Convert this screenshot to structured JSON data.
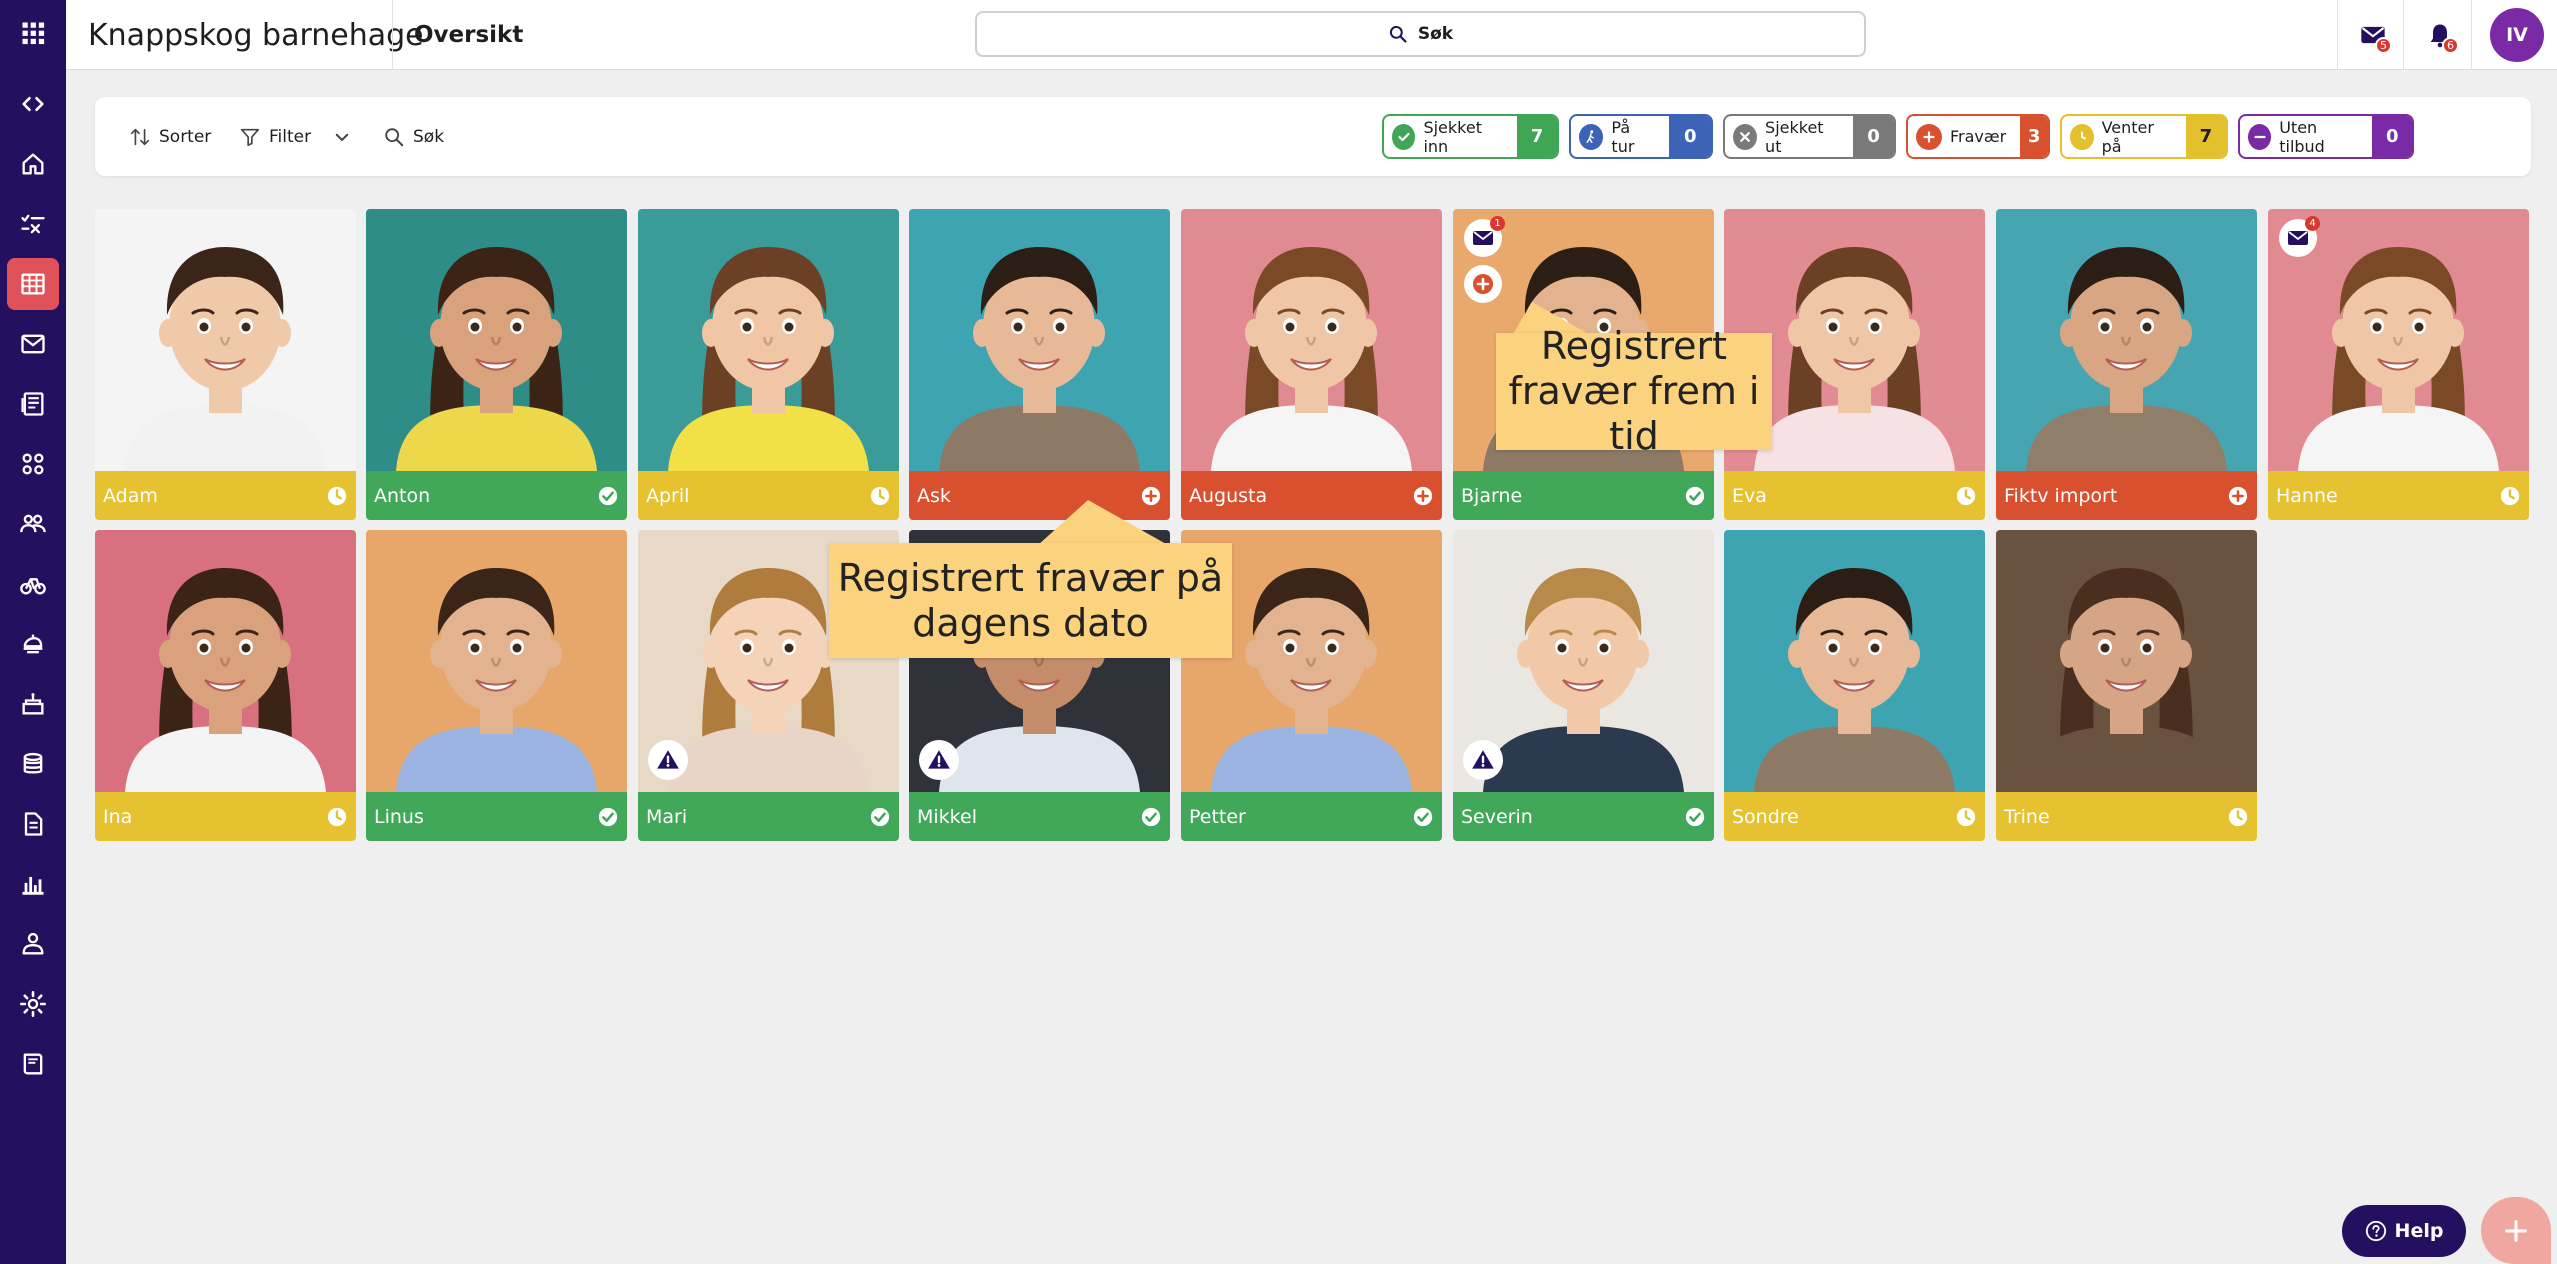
{
  "app": {
    "org_name": "Knappskog barnehage",
    "page_title": "Oversikt",
    "search_label": "Søk",
    "messages_badge": "5",
    "notifications_badge": "6",
    "avatar_initials": "IV"
  },
  "sidebar": {
    "items": [
      {
        "icon": "code-toggle-icon"
      },
      {
        "icon": "home-icon"
      },
      {
        "icon": "checklist-icon"
      },
      {
        "icon": "calendar-grid-icon",
        "active": true
      },
      {
        "icon": "mail-icon"
      },
      {
        "icon": "newspaper-icon"
      },
      {
        "icon": "group-icon"
      },
      {
        "icon": "people-icon"
      },
      {
        "icon": "bike-icon"
      },
      {
        "icon": "food-icon"
      },
      {
        "icon": "cake-icon"
      },
      {
        "icon": "coins-icon"
      },
      {
        "icon": "document-icon"
      },
      {
        "icon": "chart-icon"
      },
      {
        "icon": "staff-icon"
      },
      {
        "icon": "settings-icon"
      },
      {
        "icon": "book-icon"
      }
    ]
  },
  "toolbar": {
    "sort_label": "Sorter",
    "filter_label": "Filter",
    "search_label": "Søk"
  },
  "status_chips": [
    {
      "key": "in",
      "label": "Sjekket inn",
      "count": "7",
      "color": "#3fa656"
    },
    {
      "key": "trip",
      "label": "På tur",
      "count": "0",
      "color": "#3c63b5"
    },
    {
      "key": "out",
      "label": "Sjekket ut",
      "count": "0",
      "color": "#7a7a7a"
    },
    {
      "key": "absent",
      "label": "Fravær",
      "count": "3",
      "color": "#d9502f"
    },
    {
      "key": "waiting",
      "label": "Venter på",
      "count": "7",
      "color": "#e4c02f"
    },
    {
      "key": "none",
      "label": "Uten tilbud",
      "count": "0",
      "color": "#7b2aa6"
    }
  ],
  "colors": {
    "checked_in": "#41a85a",
    "waiting": "#e6c231",
    "absent": "#d9502f",
    "sidebar": "#24105f",
    "active_sidebar": "#e0525a"
  },
  "children": [
    {
      "name": "Adam",
      "status": "waiting",
      "bg": "#f4f4f4",
      "skin": "#f0c9a8",
      "hair": "#3a2518",
      "shirt": "#f2f2f2",
      "long_hair": false
    },
    {
      "name": "Anton",
      "status": "checked_in",
      "bg": "#2f8d88",
      "skin": "#d9a27c",
      "hair": "#3b2416",
      "shirt": "#ecd84a",
      "long_hair": true
    },
    {
      "name": "April",
      "status": "waiting",
      "bg": "#3a9b98",
      "skin": "#f0c6a5",
      "hair": "#6b4024",
      "shirt": "#f1e046",
      "long_hair": true
    },
    {
      "name": "Ask",
      "status": "absent",
      "bg": "#3fa4b2",
      "skin": "#e8b996",
      "hair": "#2c1d15",
      "shirt": "#8c7a66",
      "long_hair": false
    },
    {
      "name": "Augusta",
      "status": "absent",
      "bg": "#e28a91",
      "skin": "#f0c7a6",
      "hair": "#7a4a26",
      "shirt": "#f5f5f5",
      "long_hair": true
    },
    {
      "name": "Bjarne",
      "status": "checked_in",
      "bg": "#e9a96d",
      "skin": "#e2b38e",
      "hair": "#2c1d15",
      "shirt": "#8c7a66",
      "long_hair": false,
      "mail": "1",
      "absence_plus": true
    },
    {
      "name": "Eva",
      "status": "waiting",
      "bg": "#e38b93",
      "skin": "#f0c7a6",
      "hair": "#6b4024",
      "shirt": "#f6e1e4",
      "long_hair": true
    },
    {
      "name": "Fiktv import",
      "status": "absent",
      "bg": "#47a5b1",
      "skin": "#d9a683",
      "hair": "#2c1d15",
      "shirt": "#8f7e6a",
      "long_hair": false
    },
    {
      "name": "Hanne",
      "status": "waiting",
      "bg": "#e28a91",
      "skin": "#f0c7a6",
      "hair": "#7a4a26",
      "shirt": "#f5f5f5",
      "long_hair": true,
      "mail": "4"
    },
    {
      "name": "Ina",
      "status": "waiting",
      "bg": "#d8707f",
      "skin": "#d9a27c",
      "hair": "#3b2416",
      "shirt": "#f4f4f4",
      "long_hair": true
    },
    {
      "name": "Linus",
      "status": "checked_in",
      "bg": "#e7a66a",
      "skin": "#e2b38e",
      "hair": "#3a2518",
      "shirt": "#9ab3e0",
      "long_hair": false
    },
    {
      "name": "Mari",
      "status": "checked_in",
      "bg": "#e8d8c6",
      "skin": "#f4d3b8",
      "hair": "#b07c3e",
      "shirt": "#e9d4c8",
      "long_hair": true,
      "warning": true
    },
    {
      "name": "Mikkel",
      "status": "checked_in",
      "bg": "#2f3238",
      "skin": "#c48c68",
      "hair": "#2a1a12",
      "shirt": "#dfe5ec",
      "long_hair": false,
      "warning": true
    },
    {
      "name": "Petter",
      "status": "checked_in",
      "bg": "#e7a66a",
      "skin": "#e2b38e",
      "hair": "#3a2518",
      "shirt": "#9ab3e0",
      "long_hair": false
    },
    {
      "name": "Severin",
      "status": "checked_in",
      "bg": "#eae7e3",
      "skin": "#f1c9a8",
      "hair": "#b88a4a",
      "shirt": "#2b3a4f",
      "long_hair": false,
      "warning": true
    },
    {
      "name": "Sondre",
      "status": "waiting",
      "bg": "#3fa4b2",
      "skin": "#e8b996",
      "hair": "#2c1d15",
      "shirt": "#8c7a66",
      "long_hair": false
    },
    {
      "name": "Trine",
      "status": "waiting",
      "bg": "#6a5240",
      "skin": "#d6a585",
      "hair": "#4a2f20",
      "shirt": "#6a5240",
      "long_hair": true
    }
  ],
  "callouts": {
    "future": "Registrert fravær frem i tid",
    "today": "Registrert fravær på dagens dato"
  },
  "help_label": "Help"
}
